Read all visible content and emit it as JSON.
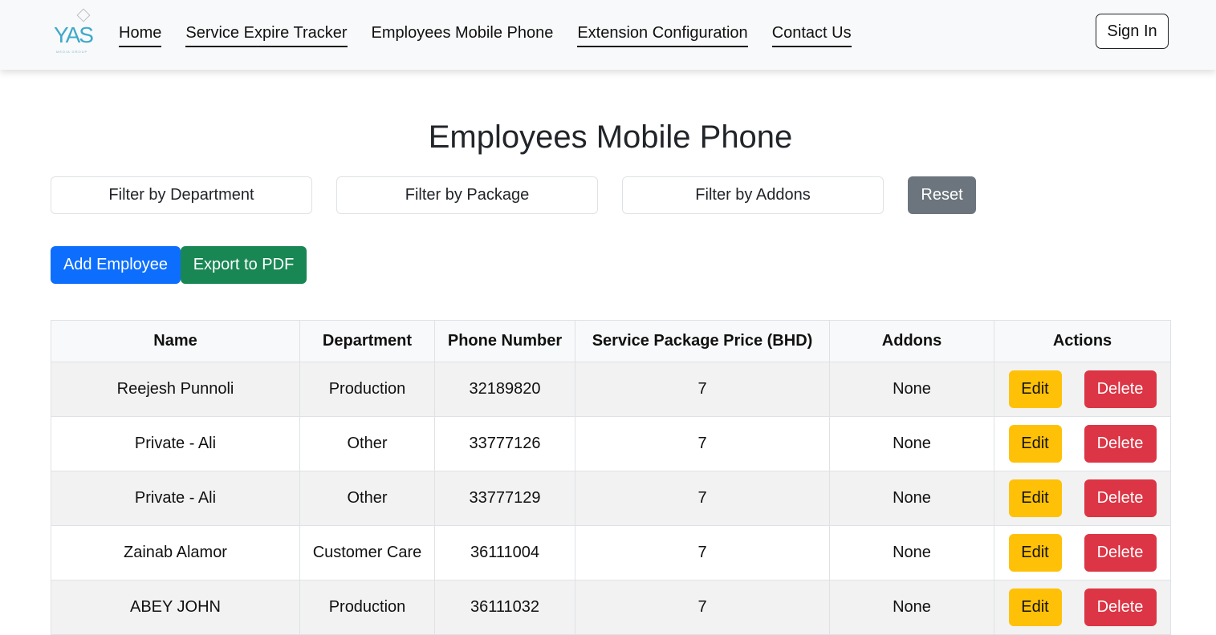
{
  "brand": {
    "logo_text": "YAS",
    "logo_subtext": "MEDIA GROUP"
  },
  "nav": {
    "links": [
      {
        "label": "Home",
        "underlined": true
      },
      {
        "label": "Service Expire Tracker",
        "underlined": true
      },
      {
        "label": "Employees Mobile Phone",
        "underlined": false
      },
      {
        "label": "Extension Configuration",
        "underlined": true
      },
      {
        "label": "Contact Us",
        "underlined": true
      }
    ],
    "signin_label": "Sign In"
  },
  "page": {
    "title": "Employees Mobile Phone"
  },
  "filters": {
    "department_placeholder": "Filter by Department",
    "package_placeholder": "Filter by Package",
    "addons_placeholder": "Filter by Addons",
    "reset_label": "Reset"
  },
  "actions": {
    "add_label": "Add Employee",
    "export_label": "Export to PDF"
  },
  "table": {
    "headers": [
      "Name",
      "Department",
      "Phone Number",
      "Service Package Price (BHD)",
      "Addons",
      "Actions"
    ],
    "edit_label": "Edit",
    "delete_label": "Delete",
    "rows": [
      {
        "name": "Reejesh Punnoli",
        "department": "Production",
        "phone": "32189820",
        "price": "7",
        "addons": "None"
      },
      {
        "name": "Private - Ali",
        "department": "Other",
        "phone": "33777126",
        "price": "7",
        "addons": "None"
      },
      {
        "name": "Private - Ali",
        "department": "Other",
        "phone": "33777129",
        "price": "7",
        "addons": "None"
      },
      {
        "name": "Zainab Alamor",
        "department": "Customer Care",
        "phone": "36111004",
        "price": "7",
        "addons": "None"
      },
      {
        "name": "ABEY JOHN",
        "department": "Production",
        "phone": "36111032",
        "price": "7",
        "addons": "None"
      }
    ]
  },
  "colors": {
    "primary": "#0d6efd",
    "success": "#198754",
    "secondary": "#6c757d",
    "warning": "#ffc107",
    "danger": "#dc3545",
    "brand": "#3fa9c9"
  }
}
